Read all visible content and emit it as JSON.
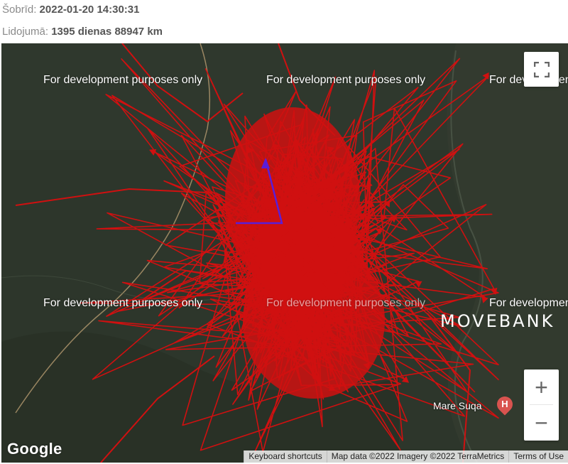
{
  "info": {
    "now_label": "Šobrīd:",
    "now_value": "2022-01-20 14:30:31",
    "flight_label": "Lidojumā:",
    "flight_value": "1395 dienas 88947 km"
  },
  "map": {
    "watermark": "For development purposes only",
    "branding": "MOVEBANK",
    "google_logo": "Google",
    "place_label": "Mare Suqa",
    "place_icon": "hospital-pin-icon",
    "place_icon_glyph": "H",
    "fullscreen_icon": "fullscreen-icon",
    "zoom_in_label": "+",
    "zoom_out_label": "−",
    "footer": {
      "keyboard": "Keyboard shortcuts",
      "mapdata": "Map data ©2022 Imagery ©2022 TerraMetrics",
      "terms": "Terms of Use"
    },
    "colors": {
      "track": "#d01010",
      "current_track": "#5a1ed8",
      "terrain": "#2d362b"
    }
  }
}
